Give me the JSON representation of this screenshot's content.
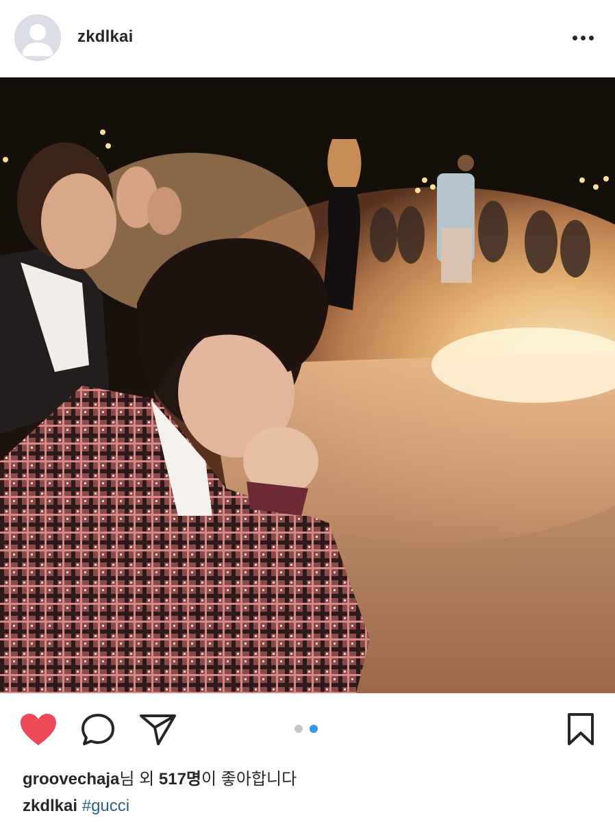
{
  "header": {
    "username": "zkdlkai",
    "avatar_icon": "default-avatar-icon",
    "more_icon": "more-options-icon"
  },
  "photo": {
    "description_icon": "post-photo"
  },
  "actions": {
    "like_icon": "heart-filled-icon",
    "like_color": "#ed4956",
    "comment_icon": "comment-icon",
    "share_icon": "send-icon",
    "bookmark_icon": "bookmark-icon",
    "carousel": {
      "total": 2,
      "active_index": 1,
      "active_color": "#3897f0",
      "inactive_color": "#c7c7c7"
    }
  },
  "likes": {
    "liker": "groovechaja",
    "middle": "님 외 ",
    "count": "517명",
    "suffix": "이 좋아합니다"
  },
  "caption": {
    "username": "zkdlkai",
    "hashtag": "#gucci"
  }
}
